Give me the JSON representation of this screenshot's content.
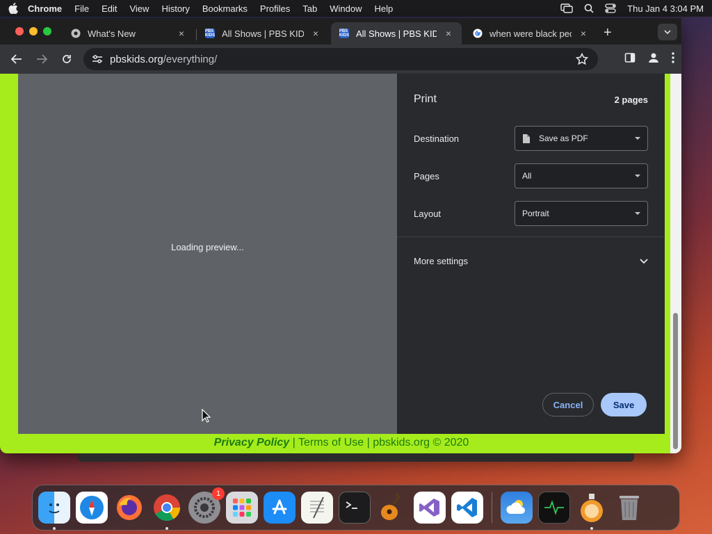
{
  "menubar": {
    "items": [
      "Chrome",
      "File",
      "Edit",
      "View",
      "History",
      "Bookmarks",
      "Profiles",
      "Tab",
      "Window",
      "Help"
    ],
    "datetime": "Thu Jan 4  3:04 PM"
  },
  "tabs": [
    {
      "title": "What's New",
      "favicon": "chrome-icon",
      "close": "×"
    },
    {
      "title": "All Shows | PBS KIDS",
      "favicon": "pbs-kids-icon",
      "close": "×"
    },
    {
      "title": "All Shows | PBS KIDS",
      "favicon": "pbs-kids-icon",
      "close": "×",
      "active": true
    },
    {
      "title": "when were black peo",
      "favicon": "google-icon",
      "close": "×"
    }
  ],
  "favicon_text": "PBS KIDS",
  "newtab": "+",
  "omnibox": {
    "host": "pbskids.org",
    "path": "/everything/"
  },
  "preview": {
    "loading": "Loading preview..."
  },
  "print": {
    "title": "Print",
    "pages_count": "2 pages",
    "destination": {
      "label": "Destination",
      "value": "Save as PDF"
    },
    "pages": {
      "label": "Pages",
      "value": "All"
    },
    "layout": {
      "label": "Layout",
      "value": "Portrait"
    },
    "more_settings": "More settings",
    "cancel": "Cancel",
    "save": "Save"
  },
  "footer": {
    "privacy": "Privacy Policy",
    "rest": " | Terms of Use | pbskids.org © 2020"
  },
  "dock": {
    "settings_badge": "1"
  },
  "colors": {
    "page_bg": "#a6ec1c",
    "accent": "#8ab4f8",
    "save_bg": "#a8c7fa"
  }
}
